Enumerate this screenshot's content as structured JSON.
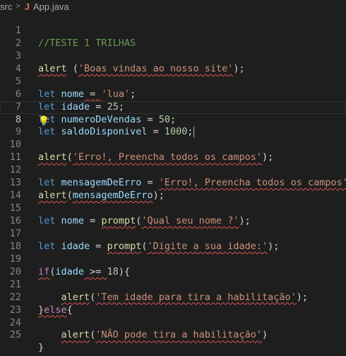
{
  "breadcrumb": {
    "folder": "src",
    "separator": ">",
    "file_icon": "J",
    "file": "App.java"
  },
  "colors": {
    "background": "#1e1e1e",
    "keyword": "#569cd6",
    "function": "#dcdcaa",
    "variable": "#9cdcfe",
    "string": "#ce9178",
    "number": "#b5cea8",
    "comment": "#6a9955",
    "error_squiggle": "#e05252"
  },
  "editor": {
    "current_line": 8,
    "line_numbers": [
      "1",
      "2",
      "3",
      "4",
      "5",
      "6",
      "7",
      "8",
      "9",
      "10",
      "11",
      "12",
      "13",
      "14",
      "15",
      "16",
      "17",
      "18",
      "19",
      "20",
      "21",
      "22",
      "23",
      "24",
      "25"
    ],
    "lines": {
      "l1": {
        "comment": "//TESTE 1 TRILHAS"
      },
      "l3": {
        "fn": "alert",
        "t1": " (",
        "str": "'Boas vindas ao nosso site'",
        "t2": ");"
      },
      "l5": {
        "kw": "let",
        "name": "nome",
        "eq": " = ",
        "val": "'lua'",
        "end": ";"
      },
      "l6": {
        "kw": "let",
        "name": "idade",
        "eq": " = ",
        "val": "25",
        "end": ";"
      },
      "l7": {
        "kw": "let",
        "name": "numeroDeVendas",
        "eq": " = ",
        "val": "50",
        "end": ";"
      },
      "l8": {
        "kw": "let",
        "name": "saldoDisponivel",
        "eq": " = ",
        "val": "1000",
        "end": ";"
      },
      "l9": {
        "icon": "lightbulb-icon"
      },
      "l10": {
        "fn": "alert",
        "t1": "(",
        "str": "'Erro!, Preencha todos os campos'",
        "t2": ");"
      },
      "l12": {
        "kw": "let",
        "name": "mensagemDeErro",
        "eq": " = ",
        "str": "'Erro!, Preencha todos os campos'",
        "end": ";"
      },
      "l13": {
        "fn": "alert",
        "t1": "(",
        "arg": "mensagemDeErro",
        "t2": ");"
      },
      "l15": {
        "kw": "let",
        "name": "nome",
        "eq": " = ",
        "fn": "prompt",
        "t1": "(",
        "str": "'Qual seu nome ?'",
        "t2": ");"
      },
      "l17": {
        "kw": "let",
        "name": "idade",
        "eq": " = ",
        "fn": "prompt",
        "t1": "(",
        "str": "'Digite a sua idade:'",
        "t2": ");"
      },
      "l19": {
        "kw": "if",
        "t1": "(",
        "name": "idade",
        "op": " >= ",
        "num": "18",
        "t2": "){"
      },
      "l21": {
        "indent": "    ",
        "fn": "alert",
        "t1": "(",
        "str": "'Tem idade para tira a habilitação'",
        "t2": ");"
      },
      "l22": {
        "t1": "}",
        "kw": "else",
        "t2": "{"
      },
      "l24": {
        "indent": "    ",
        "fn": "alert",
        "t1": "(",
        "str": "'NÃO pode tira a habilitação'",
        "t2": ")"
      },
      "l25": {
        "t1": "}"
      }
    }
  }
}
